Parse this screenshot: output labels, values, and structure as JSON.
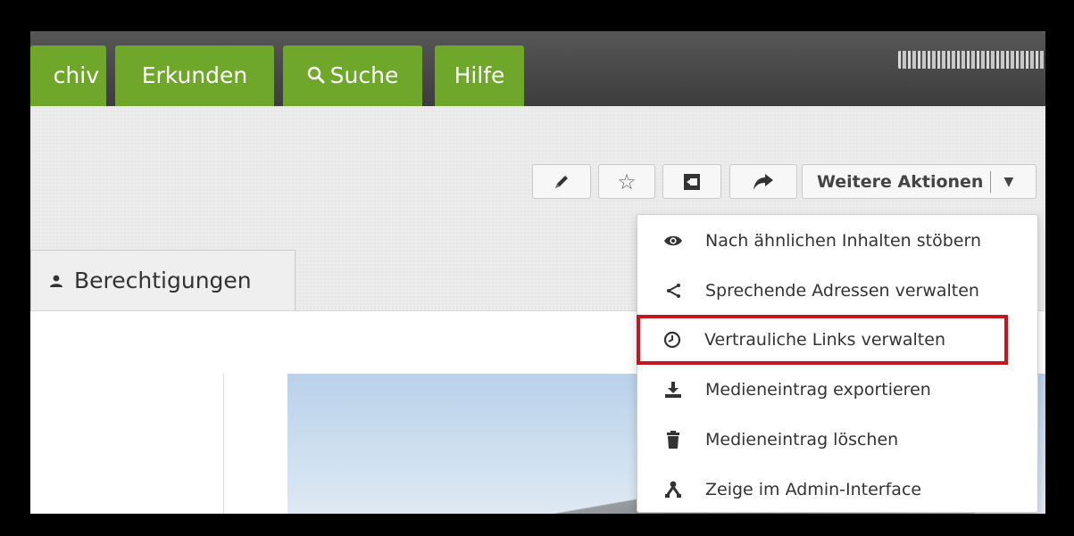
{
  "nav": {
    "tabs": [
      {
        "label": "chiv"
      },
      {
        "label": "Erkunden"
      },
      {
        "label": "Suche"
      },
      {
        "label": "Hilfe"
      }
    ],
    "accent_color": "#6fa72a"
  },
  "toolbar": {
    "more_actions_label": "Weitere Aktionen",
    "icons": [
      "pencil-icon",
      "star-icon",
      "collection-icon",
      "share-icon"
    ]
  },
  "tabs": {
    "permissions_label": "Berechtigungen"
  },
  "dropdown": {
    "items": [
      {
        "label": "Nach ähnlichen Inhalten stöbern",
        "icon": "eye-icon"
      },
      {
        "label": "Sprechende Adressen verwalten",
        "icon": "share-alt-icon"
      },
      {
        "label": "Vertrauliche Links verwalten",
        "icon": "clock-icon",
        "highlighted": true
      },
      {
        "label": "Medieneintrag exportieren",
        "icon": "download-icon"
      },
      {
        "label": "Medieneintrag löschen",
        "icon": "trash-icon"
      },
      {
        "label": "Zeige im Admin-Interface",
        "icon": "sitemap-icon"
      }
    ],
    "highlight_color": "#c4161c"
  }
}
